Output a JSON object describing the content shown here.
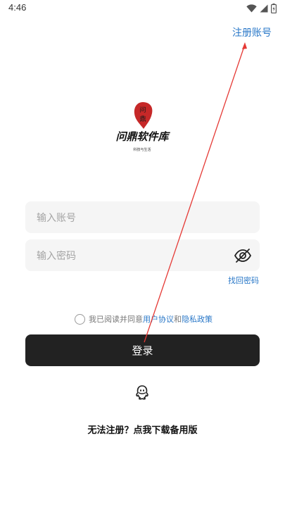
{
  "status_bar": {
    "time": "4:46"
  },
  "header": {
    "register_label": "注册账号"
  },
  "logo": {
    "badge_top": "问",
    "badge_bottom": "鼎",
    "name": "问鼎软件库",
    "tagline": "科技与生活",
    "accent_color": "#c62828"
  },
  "form": {
    "account_placeholder": "输入账号",
    "account_value": "",
    "password_placeholder": "输入密码",
    "password_value": "",
    "eye_icon": "eye-off-icon",
    "forgot_label": "找回密码"
  },
  "agreement": {
    "prefix": "我已阅读并同意",
    "user_agreement": "用户协议",
    "conjunction": "和",
    "privacy_policy": "隐私政策",
    "checked": false
  },
  "login": {
    "label": "登录"
  },
  "alt_login": {
    "icon": "qq-icon"
  },
  "backup": {
    "label": "无法注册？点我下载备用版"
  },
  "colors": {
    "link": "#2a78c8",
    "button": "#222222",
    "field_bg": "#f5f5f5",
    "annotation": "#e53935"
  }
}
